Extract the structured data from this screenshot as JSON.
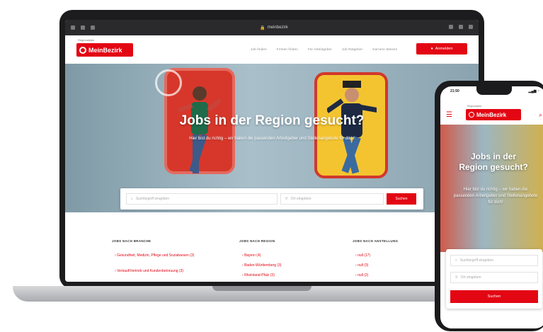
{
  "browser": {
    "url": "meinbezirk"
  },
  "site": {
    "logo_text": "MeinBezirk",
    "logo_sup": "Regionaljobs",
    "nav": [
      "Job finden",
      "Firmen finden",
      "Für Arbeitgeber",
      "Job Ratgeber",
      "Karriere Wissen"
    ],
    "login_label": "Anmelden",
    "hero": {
      "title": "Jobs in der Region gesucht?",
      "subtitle": "Hier bist du richtig – wir haben die passenden Arbeitgeber und Stellenangebote für dich!"
    },
    "search": {
      "keyword_placeholder": "Suchbegriff eingeben",
      "location_placeholder": "Ort eingeben",
      "button_label": "Suchen"
    },
    "columns": [
      {
        "title": "JOBS NACH BRANCHE",
        "items": [
          "Gesundheit, Medizin, Pflege und Sozialwesen (3)",
          "Verkauf/Vertrieb und Kundenbetreuung (3)"
        ]
      },
      {
        "title": "JOBS NACH REGION",
        "items": [
          "Bayern (4)",
          "Baden-Württemberg (3)",
          "Rheinland-Pfalz (3)"
        ]
      },
      {
        "title": "JOBS NACH ANSTELLUNG",
        "items": [
          "null (17)",
          "null (3)",
          "null (2)"
        ]
      }
    ]
  },
  "phone": {
    "time": "21:50",
    "status_right": "▂▄▆ ◔",
    "logo_text": "MeinBezirk",
    "logo_sup": "Regionaljobs",
    "hero_title_line1": "Jobs in der",
    "hero_title_line2": "Region gesucht?",
    "hero_subtitle": "Hier bist du richtig – wir haben die passenden Arbeitgeber und Stellenangebote für dich!",
    "keyword_placeholder": "Suchbegriff eingeben",
    "location_placeholder": "Ort eingeben",
    "button_label": "Suchen"
  }
}
